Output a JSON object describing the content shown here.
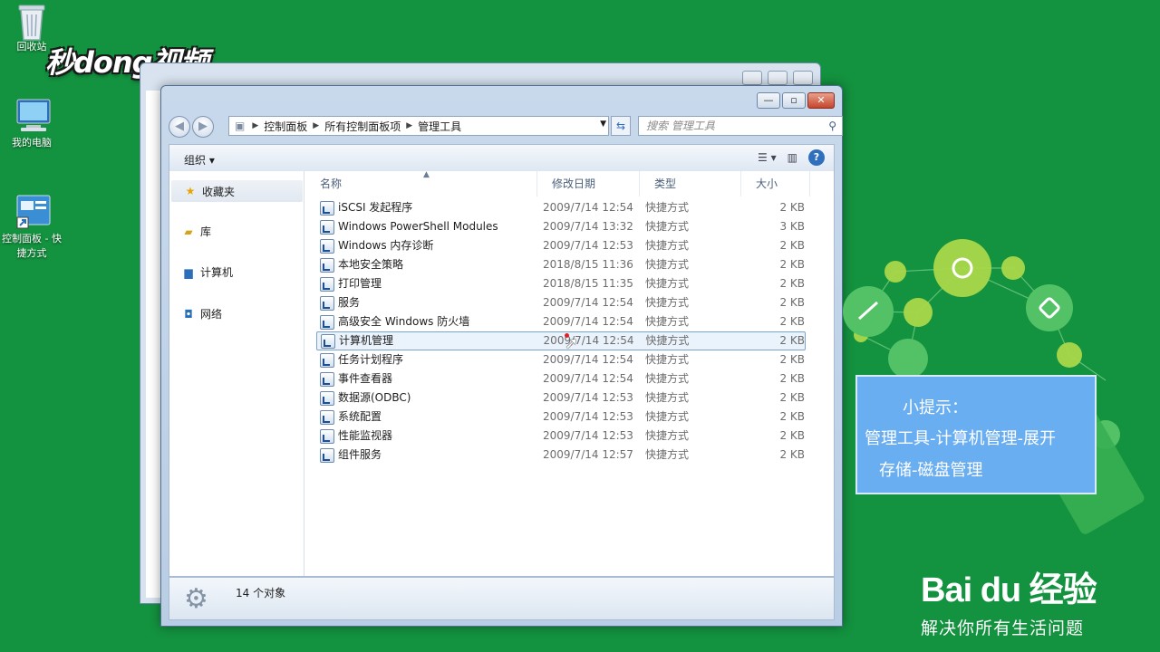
{
  "desktop": {
    "logo": "秒dong视频",
    "icons": [
      {
        "label": "回收站"
      },
      {
        "label": "我的电脑"
      },
      {
        "label": "控制面板 - 快捷方式"
      }
    ]
  },
  "window": {
    "breadcrumb": [
      "控制面板",
      "所有控制面板项",
      "管理工具"
    ],
    "search_placeholder": "搜索 管理工具",
    "toolbar": {
      "organize": "组织 ▾"
    },
    "nav": [
      {
        "label": "收藏夹"
      },
      {
        "label": "库"
      },
      {
        "label": "计算机"
      },
      {
        "label": "网络"
      }
    ],
    "columns": {
      "name": "名称",
      "date": "修改日期",
      "type": "类型",
      "size": "大小"
    },
    "files": [
      {
        "name": "iSCSI 发起程序",
        "date": "2009/7/14 12:54",
        "type": "快捷方式",
        "size": "2 KB"
      },
      {
        "name": "Windows PowerShell Modules",
        "date": "2009/7/14 13:32",
        "type": "快捷方式",
        "size": "3 KB"
      },
      {
        "name": "Windows 内存诊断",
        "date": "2009/7/14 12:53",
        "type": "快捷方式",
        "size": "2 KB"
      },
      {
        "name": "本地安全策略",
        "date": "2018/8/15 11:36",
        "type": "快捷方式",
        "size": "2 KB"
      },
      {
        "name": "打印管理",
        "date": "2018/8/15 11:35",
        "type": "快捷方式",
        "size": "2 KB"
      },
      {
        "name": "服务",
        "date": "2009/7/14 12:54",
        "type": "快捷方式",
        "size": "2 KB"
      },
      {
        "name": "高级安全 Windows 防火墙",
        "date": "2009/7/14 12:54",
        "type": "快捷方式",
        "size": "2 KB"
      },
      {
        "name": "计算机管理",
        "date": "2009/7/14 12:54",
        "type": "快捷方式",
        "size": "2 KB"
      },
      {
        "name": "任务计划程序",
        "date": "2009/7/14 12:54",
        "type": "快捷方式",
        "size": "2 KB"
      },
      {
        "name": "事件查看器",
        "date": "2009/7/14 12:54",
        "type": "快捷方式",
        "size": "2 KB"
      },
      {
        "name": "数据源(ODBC)",
        "date": "2009/7/14 12:53",
        "type": "快捷方式",
        "size": "2 KB"
      },
      {
        "name": "系统配置",
        "date": "2009/7/14 12:53",
        "type": "快捷方式",
        "size": "2 KB"
      },
      {
        "name": "性能监视器",
        "date": "2009/7/14 12:53",
        "type": "快捷方式",
        "size": "2 KB"
      },
      {
        "name": "组件服务",
        "date": "2009/7/14 12:57",
        "type": "快捷方式",
        "size": "2 KB"
      }
    ],
    "status": "14 个对象"
  },
  "tip": {
    "title": "小提示：",
    "line1": "管理工具-计算机管理-展开",
    "line2": "存储-磁盘管理"
  },
  "baidu": {
    "logo": "Bai du 经验",
    "slogan": "解决你所有生活问题"
  },
  "colors": {
    "desktop": "#13923f",
    "tip": "#6aaef2"
  }
}
